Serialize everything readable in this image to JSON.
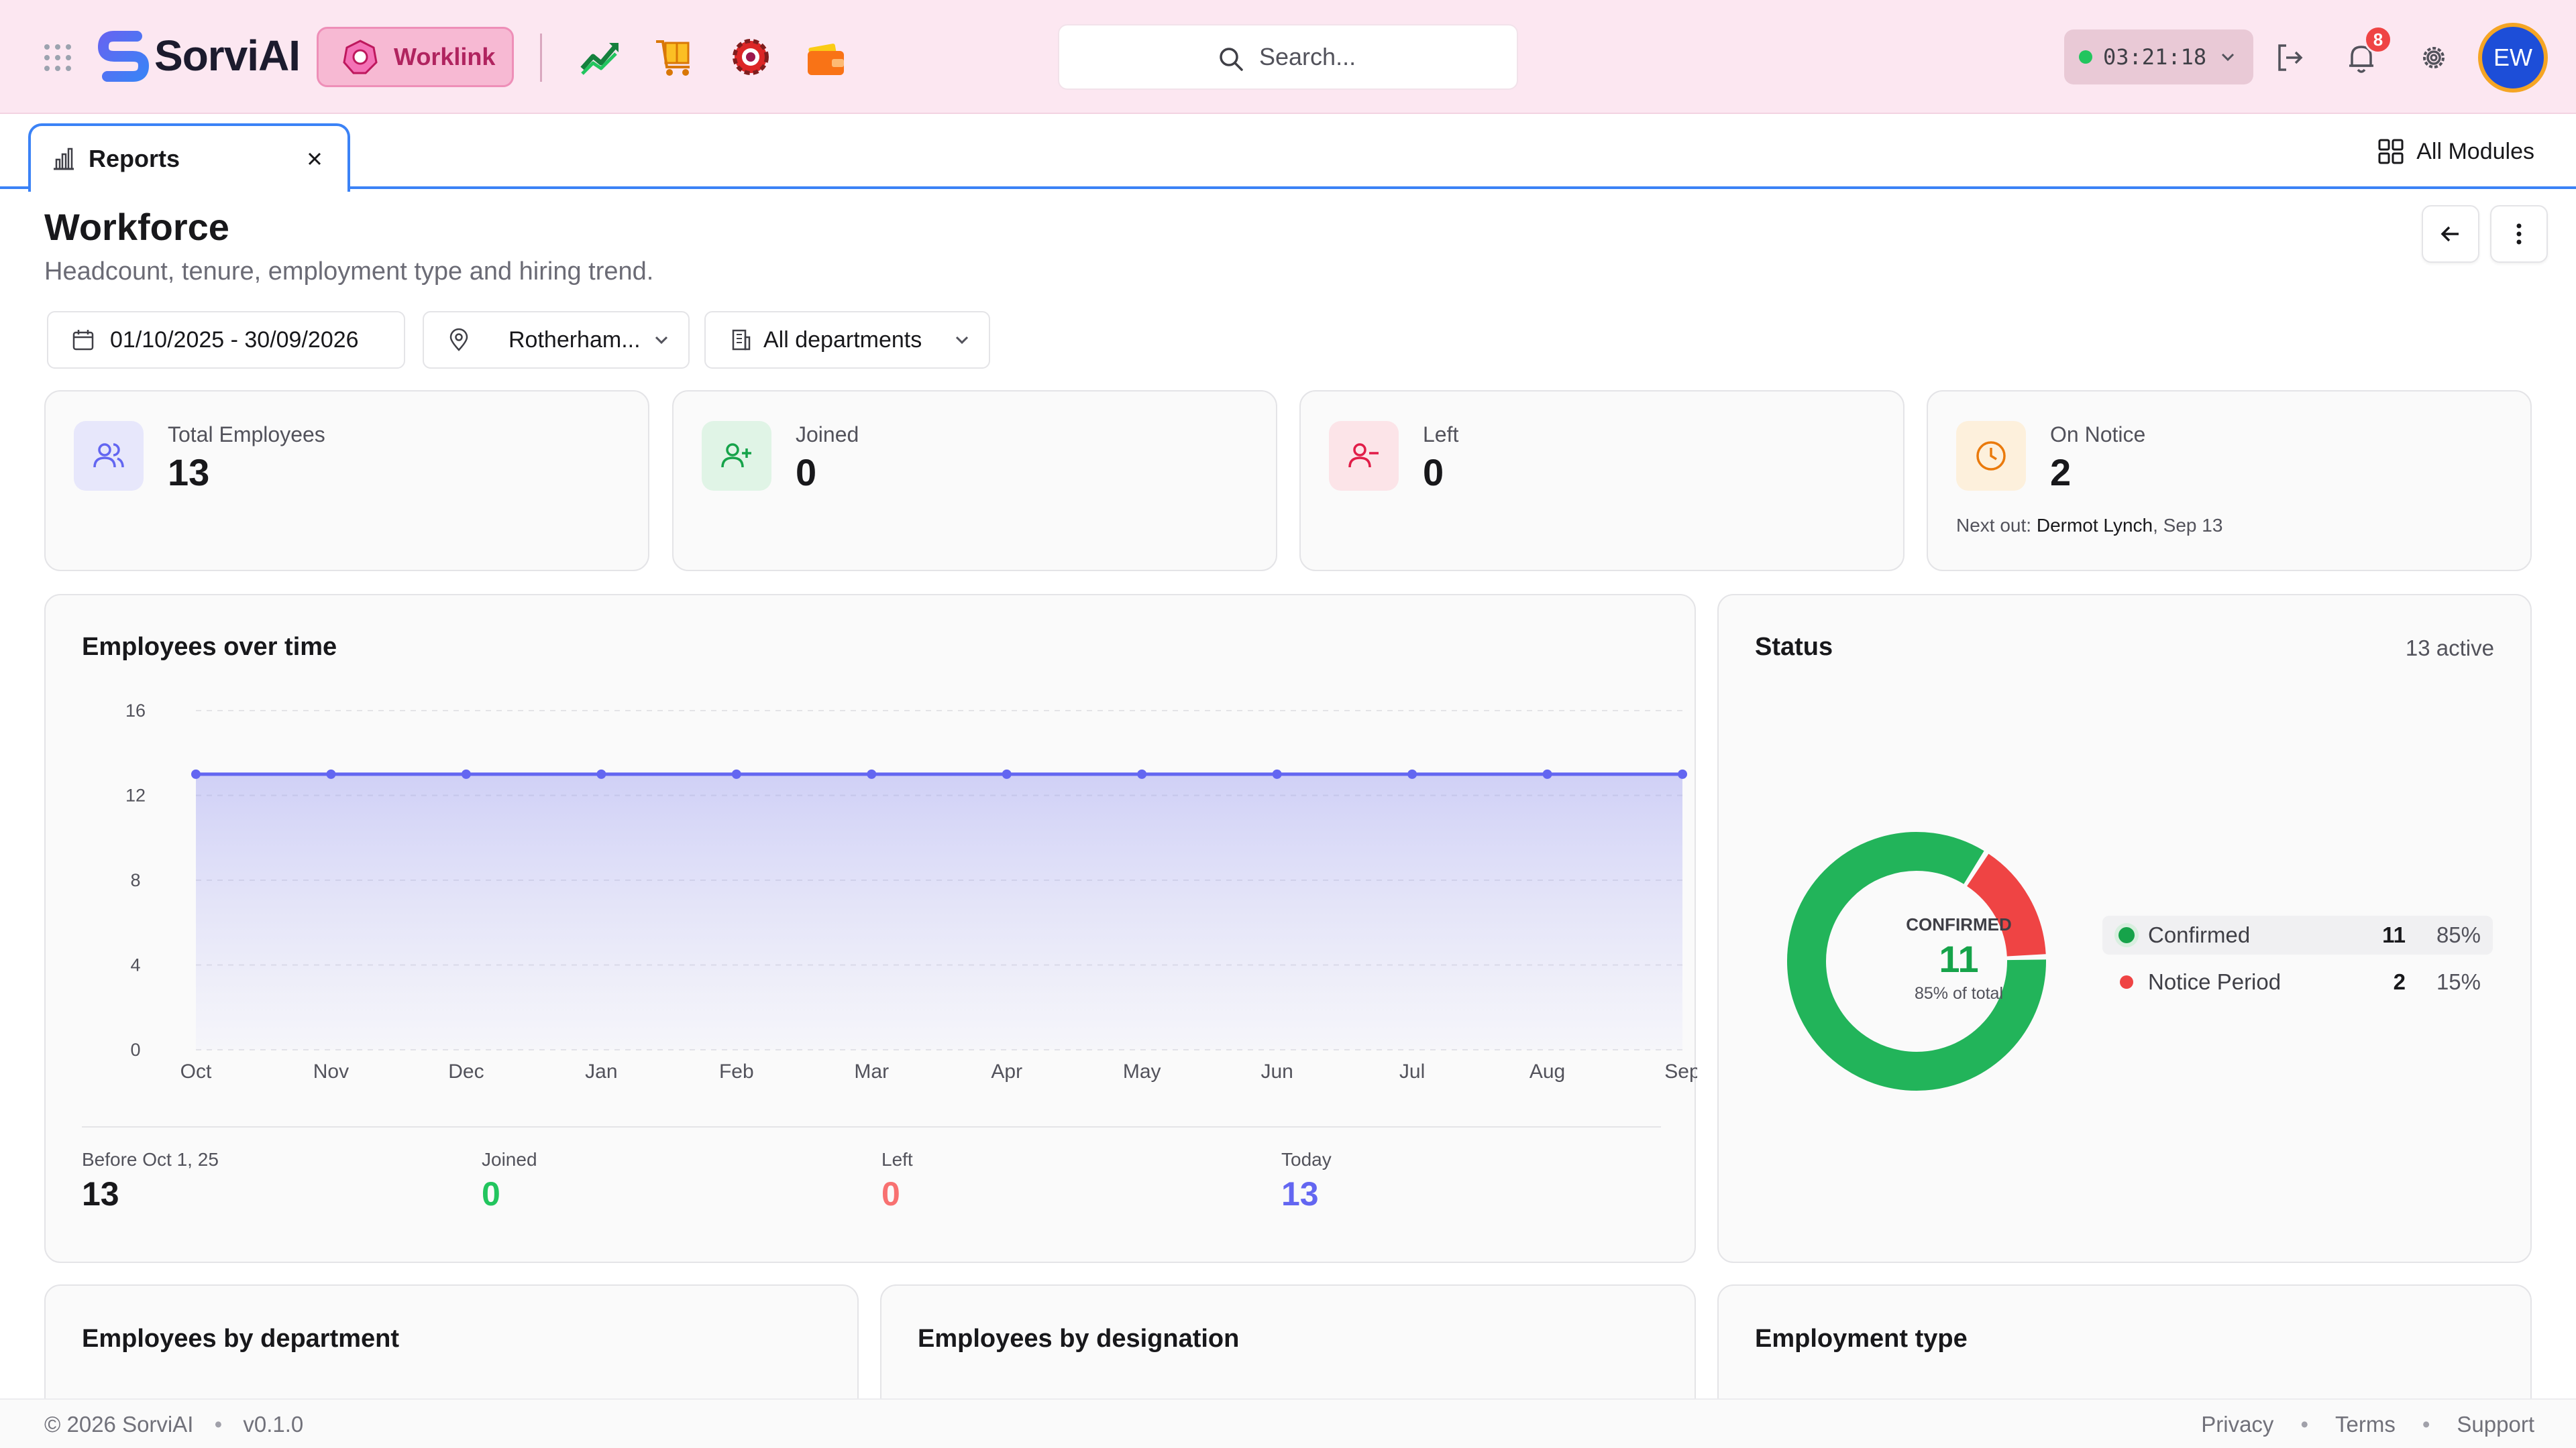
{
  "brand": {
    "name": "SorviAI"
  },
  "top": {
    "module_label": "Worklink",
    "search_placeholder": "Search...",
    "timer": "03:21:18",
    "notification_count": "8",
    "avatar_initials": "EW",
    "apps": [
      "trending-chart-icon",
      "box-cart-icon",
      "gear-target-icon",
      "wallet-icon"
    ]
  },
  "tabs": {
    "active_label": "Reports",
    "all_modules": "All Modules"
  },
  "page": {
    "title": "Workforce",
    "subtitle": "Headcount, tenure, employment type and hiring trend."
  },
  "filters": {
    "date_range": "01/10/2025 - 30/09/2026",
    "location": "Rotherham...",
    "department": "All departments"
  },
  "stats": [
    {
      "label": "Total Employees",
      "value": "13",
      "color": "#6366f1"
    },
    {
      "label": "Joined",
      "value": "0",
      "color": "#16a34a"
    },
    {
      "label": "Left",
      "value": "0",
      "color": "#e11d48"
    },
    {
      "label": "On Notice",
      "value": "2",
      "color": "#ea7a0c",
      "note_prefix": "Next out:",
      "note_name": "Dermot Lynch",
      "note_date": ", Sep 13"
    }
  ],
  "over_time": {
    "title": "Employees over time",
    "summary": [
      {
        "label": "Before Oct 1, 25",
        "value": "13",
        "color": "#18181b"
      },
      {
        "label": "Joined",
        "value": "0",
        "color": "#22c55e"
      },
      {
        "label": "Left",
        "value": "0",
        "color": "#f87171"
      },
      {
        "label": "Today",
        "value": "13",
        "color": "#6366f1"
      }
    ]
  },
  "status": {
    "title": "Status",
    "active_note": "13 active",
    "center_label": "CONFIRMED",
    "center_value": "11",
    "center_sub": "85% of total",
    "legend": [
      {
        "name": "Confirmed",
        "count": "11",
        "pct": "85%",
        "color": "#16a34a"
      },
      {
        "name": "Notice Period",
        "count": "2",
        "pct": "15%",
        "color": "#ef4444"
      }
    ]
  },
  "bottom_panels": [
    "Employees by department",
    "Employees by designation",
    "Employment type"
  ],
  "footer": {
    "copyright": "© 2026 SorviAI",
    "version": "v0.1.0",
    "links": [
      "Privacy",
      "Terms",
      "Support"
    ]
  },
  "chart_data": [
    {
      "type": "area",
      "title": "Employees over time",
      "x": [
        "Oct",
        "Nov",
        "Dec",
        "Jan",
        "Feb",
        "Mar",
        "Apr",
        "May",
        "Jun",
        "Jul",
        "Aug",
        "Sep"
      ],
      "series": [
        {
          "values": [
            13,
            13,
            13,
            13,
            13,
            13,
            13,
            13,
            13,
            13,
            13,
            13
          ],
          "color": "#6366f1"
        }
      ],
      "yticks": [
        0,
        4,
        8,
        12,
        16
      ],
      "ylim": [
        0,
        16
      ],
      "grid": true
    },
    {
      "type": "pie",
      "title": "Status",
      "categories": [
        "Confirmed",
        "Notice Period"
      ],
      "values": [
        11,
        2
      ],
      "colors": [
        "#22b45a",
        "#ef4444"
      ]
    }
  ]
}
